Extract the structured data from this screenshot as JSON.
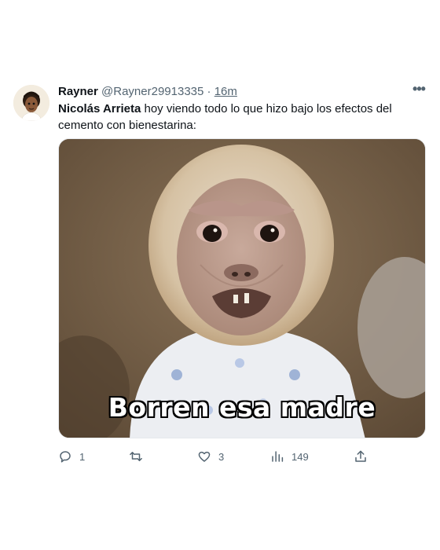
{
  "tweet": {
    "author": {
      "name": "Rayner",
      "handle": "@Rayner29913335",
      "separator": "·",
      "time": "16m"
    },
    "more_label": "•••",
    "text": {
      "mention": "Nicolás Arrieta",
      "body": " hoy viendo todo lo que hizo bajo los efectos del cemento con bienestarina:"
    },
    "media": {
      "caption": "Borren esa madre"
    },
    "actions": {
      "reply_count": "1",
      "retweet_count": "",
      "like_count": "3",
      "views_count": "149"
    }
  },
  "icons": {
    "reply": "reply-icon",
    "retweet": "retweet-icon",
    "like": "heart-icon",
    "views": "views-icon",
    "share": "share-icon",
    "more": "more-icon"
  },
  "colors": {
    "text": "#0f1419",
    "secondary": "#536471",
    "background": "#ffffff"
  }
}
